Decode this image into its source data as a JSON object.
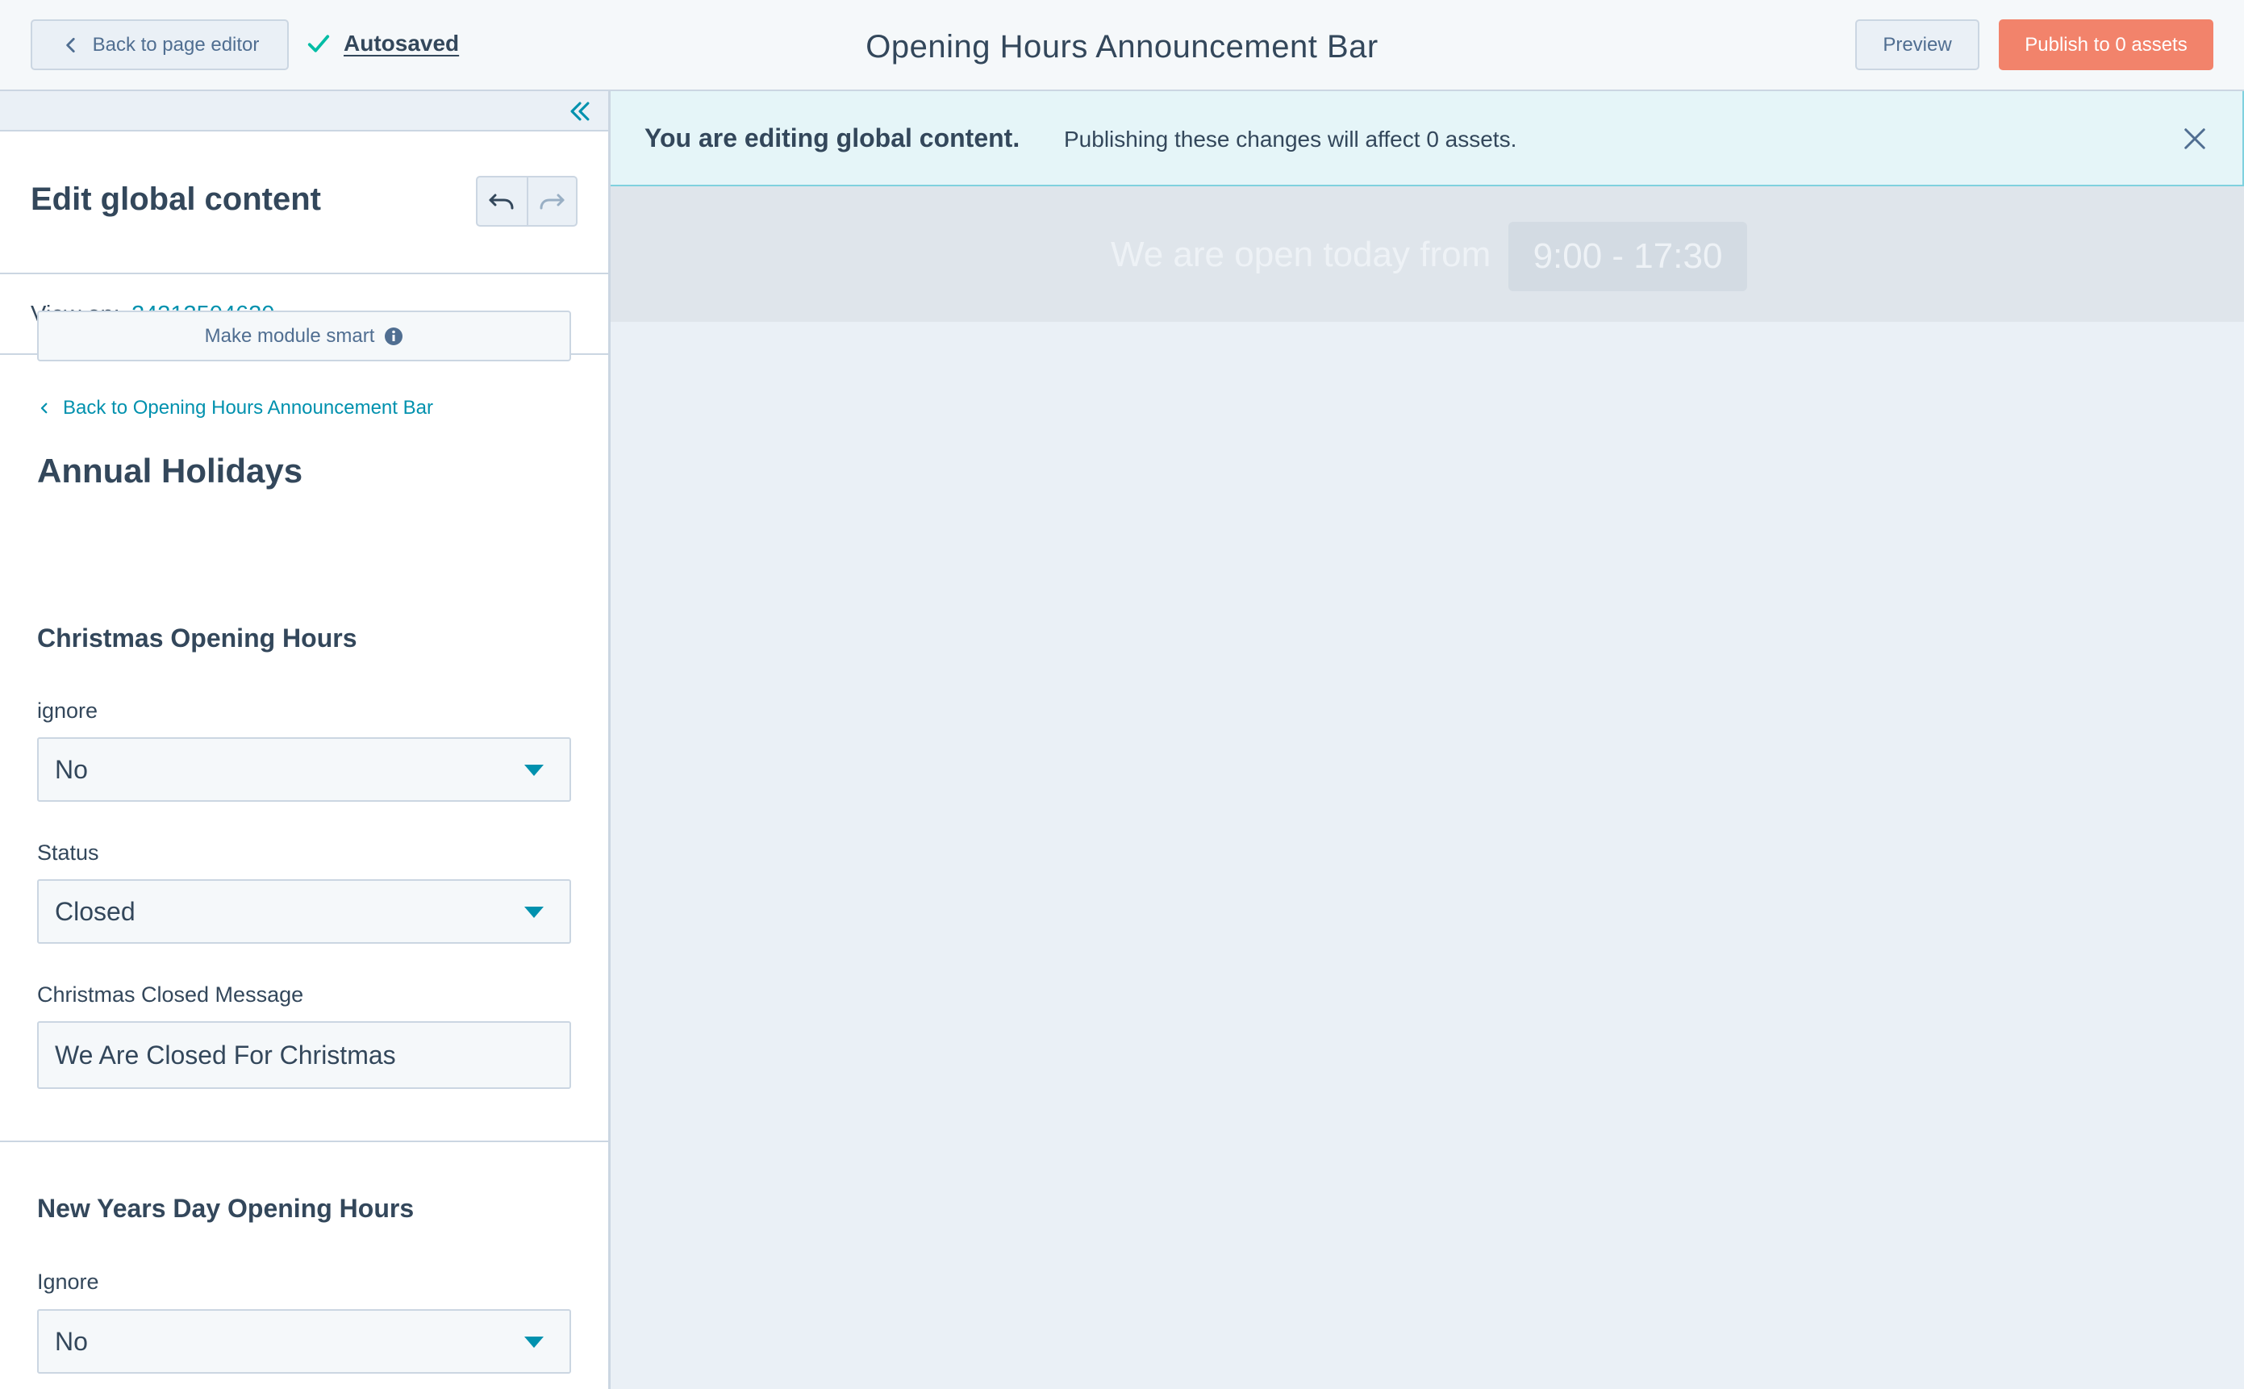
{
  "topbar": {
    "back_label": "Back to page editor",
    "autosaved_label": "Autosaved",
    "title": "Opening Hours Announcement Bar",
    "preview_label": "Preview",
    "publish_label": "Publish to 0 assets"
  },
  "sidebar": {
    "edit_title": "Edit global content",
    "view_on_label": "View on:",
    "view_on_value": "24313504620",
    "make_smart_label": "Make module smart",
    "back_link_label": "Back to Opening Hours Announcement Bar",
    "group_title": "Annual Holidays",
    "christmas": {
      "title": "Christmas Opening Hours",
      "ignore_label": "ignore",
      "ignore_value": "No",
      "status_label": "Status",
      "status_value": "Closed",
      "message_label": "Christmas Closed Message",
      "message_value": "We Are Closed For Christmas"
    },
    "new_years": {
      "title": "New Years Day Opening Hours",
      "ignore_label": "Ignore",
      "ignore_value": "No"
    }
  },
  "banner": {
    "strong": "You are editing global content.",
    "message": "Publishing these changes will affect 0 assets."
  },
  "preview": {
    "announce_text": "We are open today from",
    "announce_time": "9:00 - 17:30"
  },
  "colors": {
    "accent": "#0091ae",
    "publish": "#f2836b",
    "text": "#33475b",
    "border": "#cbd6e2"
  }
}
